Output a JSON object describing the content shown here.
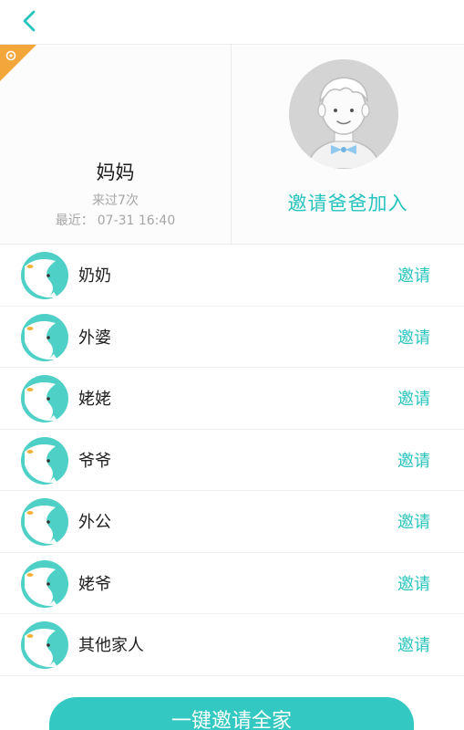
{
  "nav": {
    "back_icon": "chevron-left-icon"
  },
  "header": {
    "me": {
      "name": "妈妈",
      "visits": "来过7次",
      "recent_label": "最近：",
      "recent_time": "07-31 16:40"
    },
    "dad": {
      "avatar_icon": "boy-avatar-icon",
      "invite_label": "邀请爸爸加入"
    },
    "corner_icon": "corner-tag-icon"
  },
  "members": [
    {
      "name": "奶奶",
      "invite": "邀请"
    },
    {
      "name": "外婆",
      "invite": "邀请"
    },
    {
      "name": "姥姥",
      "invite": "邀请"
    },
    {
      "name": "爷爷",
      "invite": "邀请"
    },
    {
      "name": "外公",
      "invite": "邀请"
    },
    {
      "name": "姥爷",
      "invite": "邀请"
    },
    {
      "name": "其他家人",
      "invite": "邀请"
    }
  ],
  "footer": {
    "invite_all_label": "一键邀请全家"
  },
  "colors": {
    "accent": "#27c3be",
    "button": "#34c8c2",
    "tag": "#f3a63a"
  }
}
